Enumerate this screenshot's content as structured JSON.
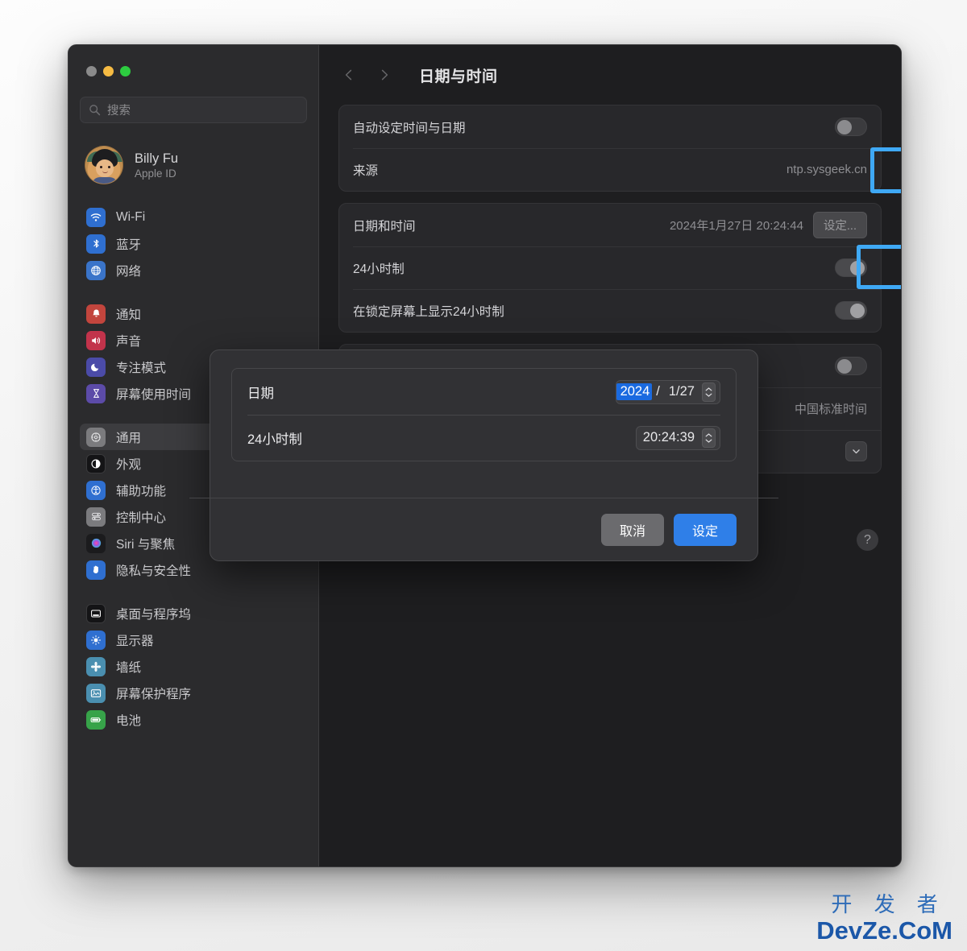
{
  "window": {
    "traffic_lights": [
      "close",
      "minimize",
      "zoom"
    ]
  },
  "sidebar": {
    "search": {
      "placeholder": "搜索",
      "icon": "search-icon"
    },
    "account": {
      "name": "Billy Fu",
      "subtitle": "Apple ID"
    },
    "groups": [
      {
        "items": [
          {
            "label": "Wi-Fi",
            "icon": "wifi-icon"
          },
          {
            "label": "蓝牙",
            "icon": "bluetooth-icon"
          },
          {
            "label": "网络",
            "icon": "network-globe-icon"
          }
        ]
      },
      {
        "items": [
          {
            "label": "通知",
            "icon": "notifications-bell-icon"
          },
          {
            "label": "声音",
            "icon": "sound-speaker-icon"
          },
          {
            "label": "专注模式",
            "icon": "focus-moon-icon"
          },
          {
            "label": "屏幕使用时间",
            "icon": "screen-time-hourglass-icon"
          }
        ]
      },
      {
        "items": [
          {
            "label": "通用",
            "icon": "general-gear-icon",
            "active": true
          },
          {
            "label": "外观",
            "icon": "appearance-contrast-icon"
          },
          {
            "label": "辅助功能",
            "icon": "accessibility-icon"
          },
          {
            "label": "控制中心",
            "icon": "control-center-icon"
          },
          {
            "label": "Siri 与聚焦",
            "icon": "siri-icon"
          },
          {
            "label": "隐私与安全性",
            "icon": "privacy-hand-icon"
          }
        ]
      },
      {
        "items": [
          {
            "label": "桌面与程序坞",
            "icon": "desktop-dock-icon"
          },
          {
            "label": "显示器",
            "icon": "displays-brightness-icon"
          },
          {
            "label": "墙纸",
            "icon": "wallpaper-icon"
          },
          {
            "label": "屏幕保护程序",
            "icon": "screensaver-icon"
          },
          {
            "label": "电池",
            "icon": "battery-icon"
          }
        ]
      }
    ]
  },
  "main": {
    "back_icon": "chevron-left-icon",
    "forward_icon": "chevron-right-icon",
    "title": "日期与时间",
    "group1": {
      "auto_label": "自动设定时间与日期",
      "auto_toggle_state": "off",
      "source_label": "来源",
      "source_value": "ntp.sysgeek.cn"
    },
    "group2": {
      "datetime_label": "日期和时间",
      "datetime_value": "2024年1月27日 20:24:44",
      "set_button": "设定...",
      "h24_label": "24小时制",
      "h24_toggle_state": "on",
      "lock_h24_label": "在锁定屏幕上显示24小时制",
      "lock_h24_toggle_state": "on"
    },
    "group3": {
      "toggle_state": "off",
      "timezone_value": "中国标准时间",
      "dropdown_icon": "chevron-down-icon"
    },
    "help_button": "?"
  },
  "modal": {
    "date_label": "日期",
    "date_year": "2024",
    "date_sep": "/",
    "date_rest": "1/27",
    "time_label": "24小时制",
    "time_value": "20:24:39",
    "stepper_icon": "stepper-up-down-icon",
    "cancel_label": "取消",
    "confirm_label": "设定"
  },
  "watermark": {
    "top": "开 发 者",
    "bottom": "DevZe.CoM"
  },
  "colors": {
    "accent_blue": "#2f7fe8",
    "highlight_blue": "#3fa9f5",
    "selection_blue": "#1a6ae0",
    "window_bg": "#232325",
    "sidebar_bg": "#2b2b2d",
    "main_bg": "#1e1e20"
  }
}
